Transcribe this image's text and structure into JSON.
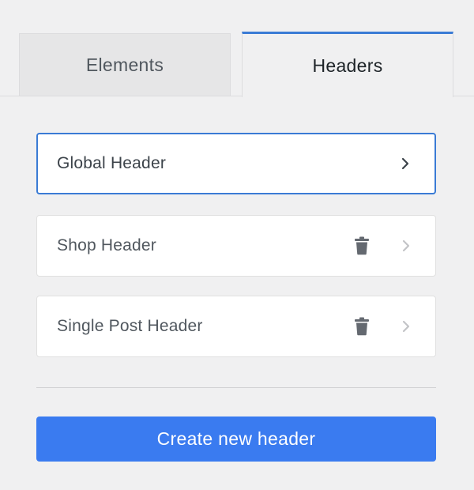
{
  "tabs": [
    {
      "label": "Elements",
      "active": false
    },
    {
      "label": "Headers",
      "active": true
    }
  ],
  "headers": [
    {
      "label": "Global Header",
      "selected": true,
      "deletable": false,
      "icons": [
        "chevron-right-icon"
      ]
    },
    {
      "label": "Shop Header",
      "selected": false,
      "deletable": true,
      "icons": [
        "trash-icon",
        "chevron-right-icon"
      ]
    },
    {
      "label": "Single Post Header",
      "selected": false,
      "deletable": true,
      "icons": [
        "trash-icon",
        "chevron-right-icon"
      ]
    }
  ],
  "create_button": {
    "label": "Create new header"
  },
  "colors": {
    "accent": "#3a7bd5",
    "button": "#3a7bf0",
    "background": "#f0f0f1",
    "card": "#ffffff",
    "icon": "#646970",
    "icon_muted": "#c3c4c7"
  }
}
